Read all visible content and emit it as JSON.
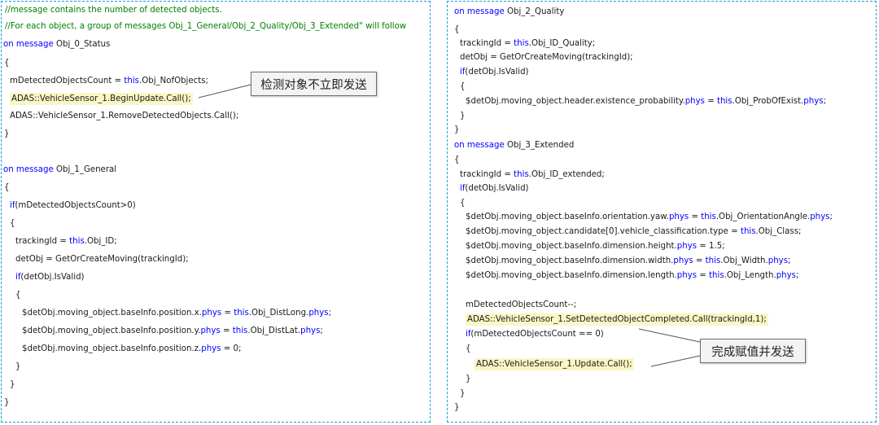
{
  "left_code": [
    [
      {
        "t": "//message contains the number of detected objects.",
        "c": "comment"
      }
    ],
    [
      {
        "t": "//For each object, a group of messages Obj_1_General/Obj_2_Quality/Obj_3_Extended\" will follow",
        "c": "comment"
      }
    ],
    [
      {
        "t": "on message",
        "c": "keyword"
      },
      {
        "t": " Obj_0_Status",
        "c": "plain"
      }
    ],
    [
      {
        "t": "{",
        "c": "plain"
      }
    ],
    [
      {
        "t": "mDetectedObjectsCount = ",
        "c": "plain"
      },
      {
        "t": "this",
        "c": "keyword"
      },
      {
        "t": ".Obj_NofObjects;",
        "c": "plain"
      }
    ],
    [
      {
        "t": "ADAS::VehicleSensor_1.BeginUpdate.Call();",
        "c": "plain",
        "hl": true
      }
    ],
    [
      {
        "t": "ADAS::VehicleSensor_1.RemoveDetectedObjects.Call();",
        "c": "plain"
      }
    ],
    [
      {
        "t": "}",
        "c": "plain"
      }
    ],
    [],
    [
      {
        "t": "on message",
        "c": "keyword"
      },
      {
        "t": " Obj_1_General",
        "c": "plain"
      }
    ],
    [
      {
        "t": "{",
        "c": "plain"
      }
    ],
    [
      {
        "t": "if",
        "c": "keyword"
      },
      {
        "t": "(mDetectedObjectsCount>0)",
        "c": "plain"
      }
    ],
    [
      {
        "t": "{",
        "c": "plain"
      }
    ],
    [
      {
        "t": "trackingId = ",
        "c": "plain"
      },
      {
        "t": "this",
        "c": "keyword"
      },
      {
        "t": ".Obj_ID;",
        "c": "plain"
      }
    ],
    [
      {
        "t": "detObj = GetOrCreateMoving(trackingId);",
        "c": "plain"
      }
    ],
    [
      {
        "t": "if",
        "c": "keyword"
      },
      {
        "t": "(detObj.IsValid)",
        "c": "plain"
      }
    ],
    [
      {
        "t": "{",
        "c": "plain"
      }
    ],
    [
      {
        "t": "$detObj.moving_object.baseInfo.position.x.",
        "c": "plain"
      },
      {
        "t": "phys",
        "c": "keyword"
      },
      {
        "t": " = ",
        "c": "plain"
      },
      {
        "t": "this",
        "c": "keyword"
      },
      {
        "t": ".Obj_DistLong.",
        "c": "plain"
      },
      {
        "t": "phys",
        "c": "keyword"
      },
      {
        "t": ";",
        "c": "plain"
      }
    ],
    [
      {
        "t": "$detObj.moving_object.baseInfo.position.y.",
        "c": "plain"
      },
      {
        "t": "phys",
        "c": "keyword"
      },
      {
        "t": " = ",
        "c": "plain"
      },
      {
        "t": "this",
        "c": "keyword"
      },
      {
        "t": ".Obj_DistLat.",
        "c": "plain"
      },
      {
        "t": "phys",
        "c": "keyword"
      },
      {
        "t": ";",
        "c": "plain"
      }
    ],
    [
      {
        "t": "$detObj.moving_object.baseInfo.position.z.",
        "c": "plain"
      },
      {
        "t": "phys",
        "c": "keyword"
      },
      {
        "t": " = 0;",
        "c": "plain"
      }
    ],
    [
      {
        "t": "}",
        "c": "plain"
      }
    ],
    [
      {
        "t": "}",
        "c": "plain"
      }
    ],
    [
      {
        "t": "}",
        "c": "plain"
      }
    ]
  ],
  "right_code": [
    [
      {
        "t": "on message",
        "c": "keyword"
      },
      {
        "t": " Obj_2_Quality",
        "c": "plain"
      }
    ],
    [
      {
        "t": "{",
        "c": "plain"
      }
    ],
    [
      {
        "t": "trackingId = ",
        "c": "plain"
      },
      {
        "t": "this",
        "c": "keyword"
      },
      {
        "t": ".Obj_ID_Quality;",
        "c": "plain"
      }
    ],
    [
      {
        "t": "detObj = GetOrCreateMoving(trackingId);",
        "c": "plain"
      }
    ],
    [
      {
        "t": "if",
        "c": "keyword"
      },
      {
        "t": "(detObj.IsValid)",
        "c": "plain"
      }
    ],
    [
      {
        "t": "{",
        "c": "plain"
      }
    ],
    [
      {
        "t": "$detObj.moving_object.header.existence_probability.",
        "c": "plain"
      },
      {
        "t": "phys",
        "c": "keyword"
      },
      {
        "t": " = ",
        "c": "plain"
      },
      {
        "t": "this",
        "c": "keyword"
      },
      {
        "t": ".Obj_ProbOfExist.",
        "c": "plain"
      },
      {
        "t": "phys",
        "c": "keyword"
      },
      {
        "t": ";",
        "c": "plain"
      }
    ],
    [
      {
        "t": "}",
        "c": "plain"
      }
    ],
    [
      {
        "t": "}",
        "c": "plain"
      }
    ],
    [
      {
        "t": "on message",
        "c": "keyword"
      },
      {
        "t": " Obj_3_Extended",
        "c": "plain"
      }
    ],
    [
      {
        "t": "{",
        "c": "plain"
      }
    ],
    [
      {
        "t": "trackingId = ",
        "c": "plain"
      },
      {
        "t": "this",
        "c": "keyword"
      },
      {
        "t": ".Obj_ID_extended;",
        "c": "plain"
      }
    ],
    [
      {
        "t": "if",
        "c": "keyword"
      },
      {
        "t": "(detObj.IsValid)",
        "c": "plain"
      }
    ],
    [
      {
        "t": "{",
        "c": "plain"
      }
    ],
    [
      {
        "t": "$detObj.moving_object.baseInfo.orientation.yaw.",
        "c": "plain"
      },
      {
        "t": "phys",
        "c": "keyword"
      },
      {
        "t": " = ",
        "c": "plain"
      },
      {
        "t": "this",
        "c": "keyword"
      },
      {
        "t": ".Obj_OrientationAngle.",
        "c": "plain"
      },
      {
        "t": "phys",
        "c": "keyword"
      },
      {
        "t": ";",
        "c": "plain"
      }
    ],
    [
      {
        "t": "$detObj.moving_object.candidate[0].vehicle_classification.type = ",
        "c": "plain"
      },
      {
        "t": "this",
        "c": "keyword"
      },
      {
        "t": ".Obj_Class;",
        "c": "plain"
      }
    ],
    [
      {
        "t": "$detObj.moving_object.baseInfo.dimension.height.",
        "c": "plain"
      },
      {
        "t": "phys",
        "c": "keyword"
      },
      {
        "t": " = 1.5;",
        "c": "plain"
      }
    ],
    [
      {
        "t": "$detObj.moving_object.baseInfo.dimension.width.",
        "c": "plain"
      },
      {
        "t": "phys",
        "c": "keyword"
      },
      {
        "t": " = ",
        "c": "plain"
      },
      {
        "t": "this",
        "c": "keyword"
      },
      {
        "t": ".Obj_Width.",
        "c": "plain"
      },
      {
        "t": "phys",
        "c": "keyword"
      },
      {
        "t": ";",
        "c": "plain"
      }
    ],
    [
      {
        "t": "$detObj.moving_object.baseInfo.dimension.length.",
        "c": "plain"
      },
      {
        "t": "phys",
        "c": "keyword"
      },
      {
        "t": " = ",
        "c": "plain"
      },
      {
        "t": "this",
        "c": "keyword"
      },
      {
        "t": ".Obj_Length.",
        "c": "plain"
      },
      {
        "t": "phys",
        "c": "keyword"
      },
      {
        "t": ";",
        "c": "plain"
      }
    ],
    [],
    [
      {
        "t": "mDetectedObjectsCount--;",
        "c": "plain"
      }
    ],
    [
      {
        "t": "ADAS::VehicleSensor_1.SetDetectedObjectCompleted.Call(trackingId,1);",
        "c": "plain",
        "hl": true
      }
    ],
    [
      {
        "t": "if",
        "c": "keyword"
      },
      {
        "t": "(mDetectedObjectsCount == 0)",
        "c": "plain"
      }
    ],
    [
      {
        "t": "{",
        "c": "plain"
      }
    ],
    [
      {
        "t": "ADAS::VehicleSensor_1.Update.Call();",
        "c": "plain",
        "hl": true
      }
    ],
    [
      {
        "t": "}",
        "c": "plain"
      }
    ],
    [
      {
        "t": "}",
        "c": "plain"
      }
    ],
    [
      {
        "t": "}",
        "c": "plain"
      }
    ]
  ],
  "callouts": {
    "left": "检测对象不立即发送",
    "right": "完成赋值并发送"
  },
  "colors": {
    "comment": "#008000",
    "keyword": "#0000ff",
    "highlight": "#fbf6c5",
    "panel_border": "#1f9fd6"
  }
}
